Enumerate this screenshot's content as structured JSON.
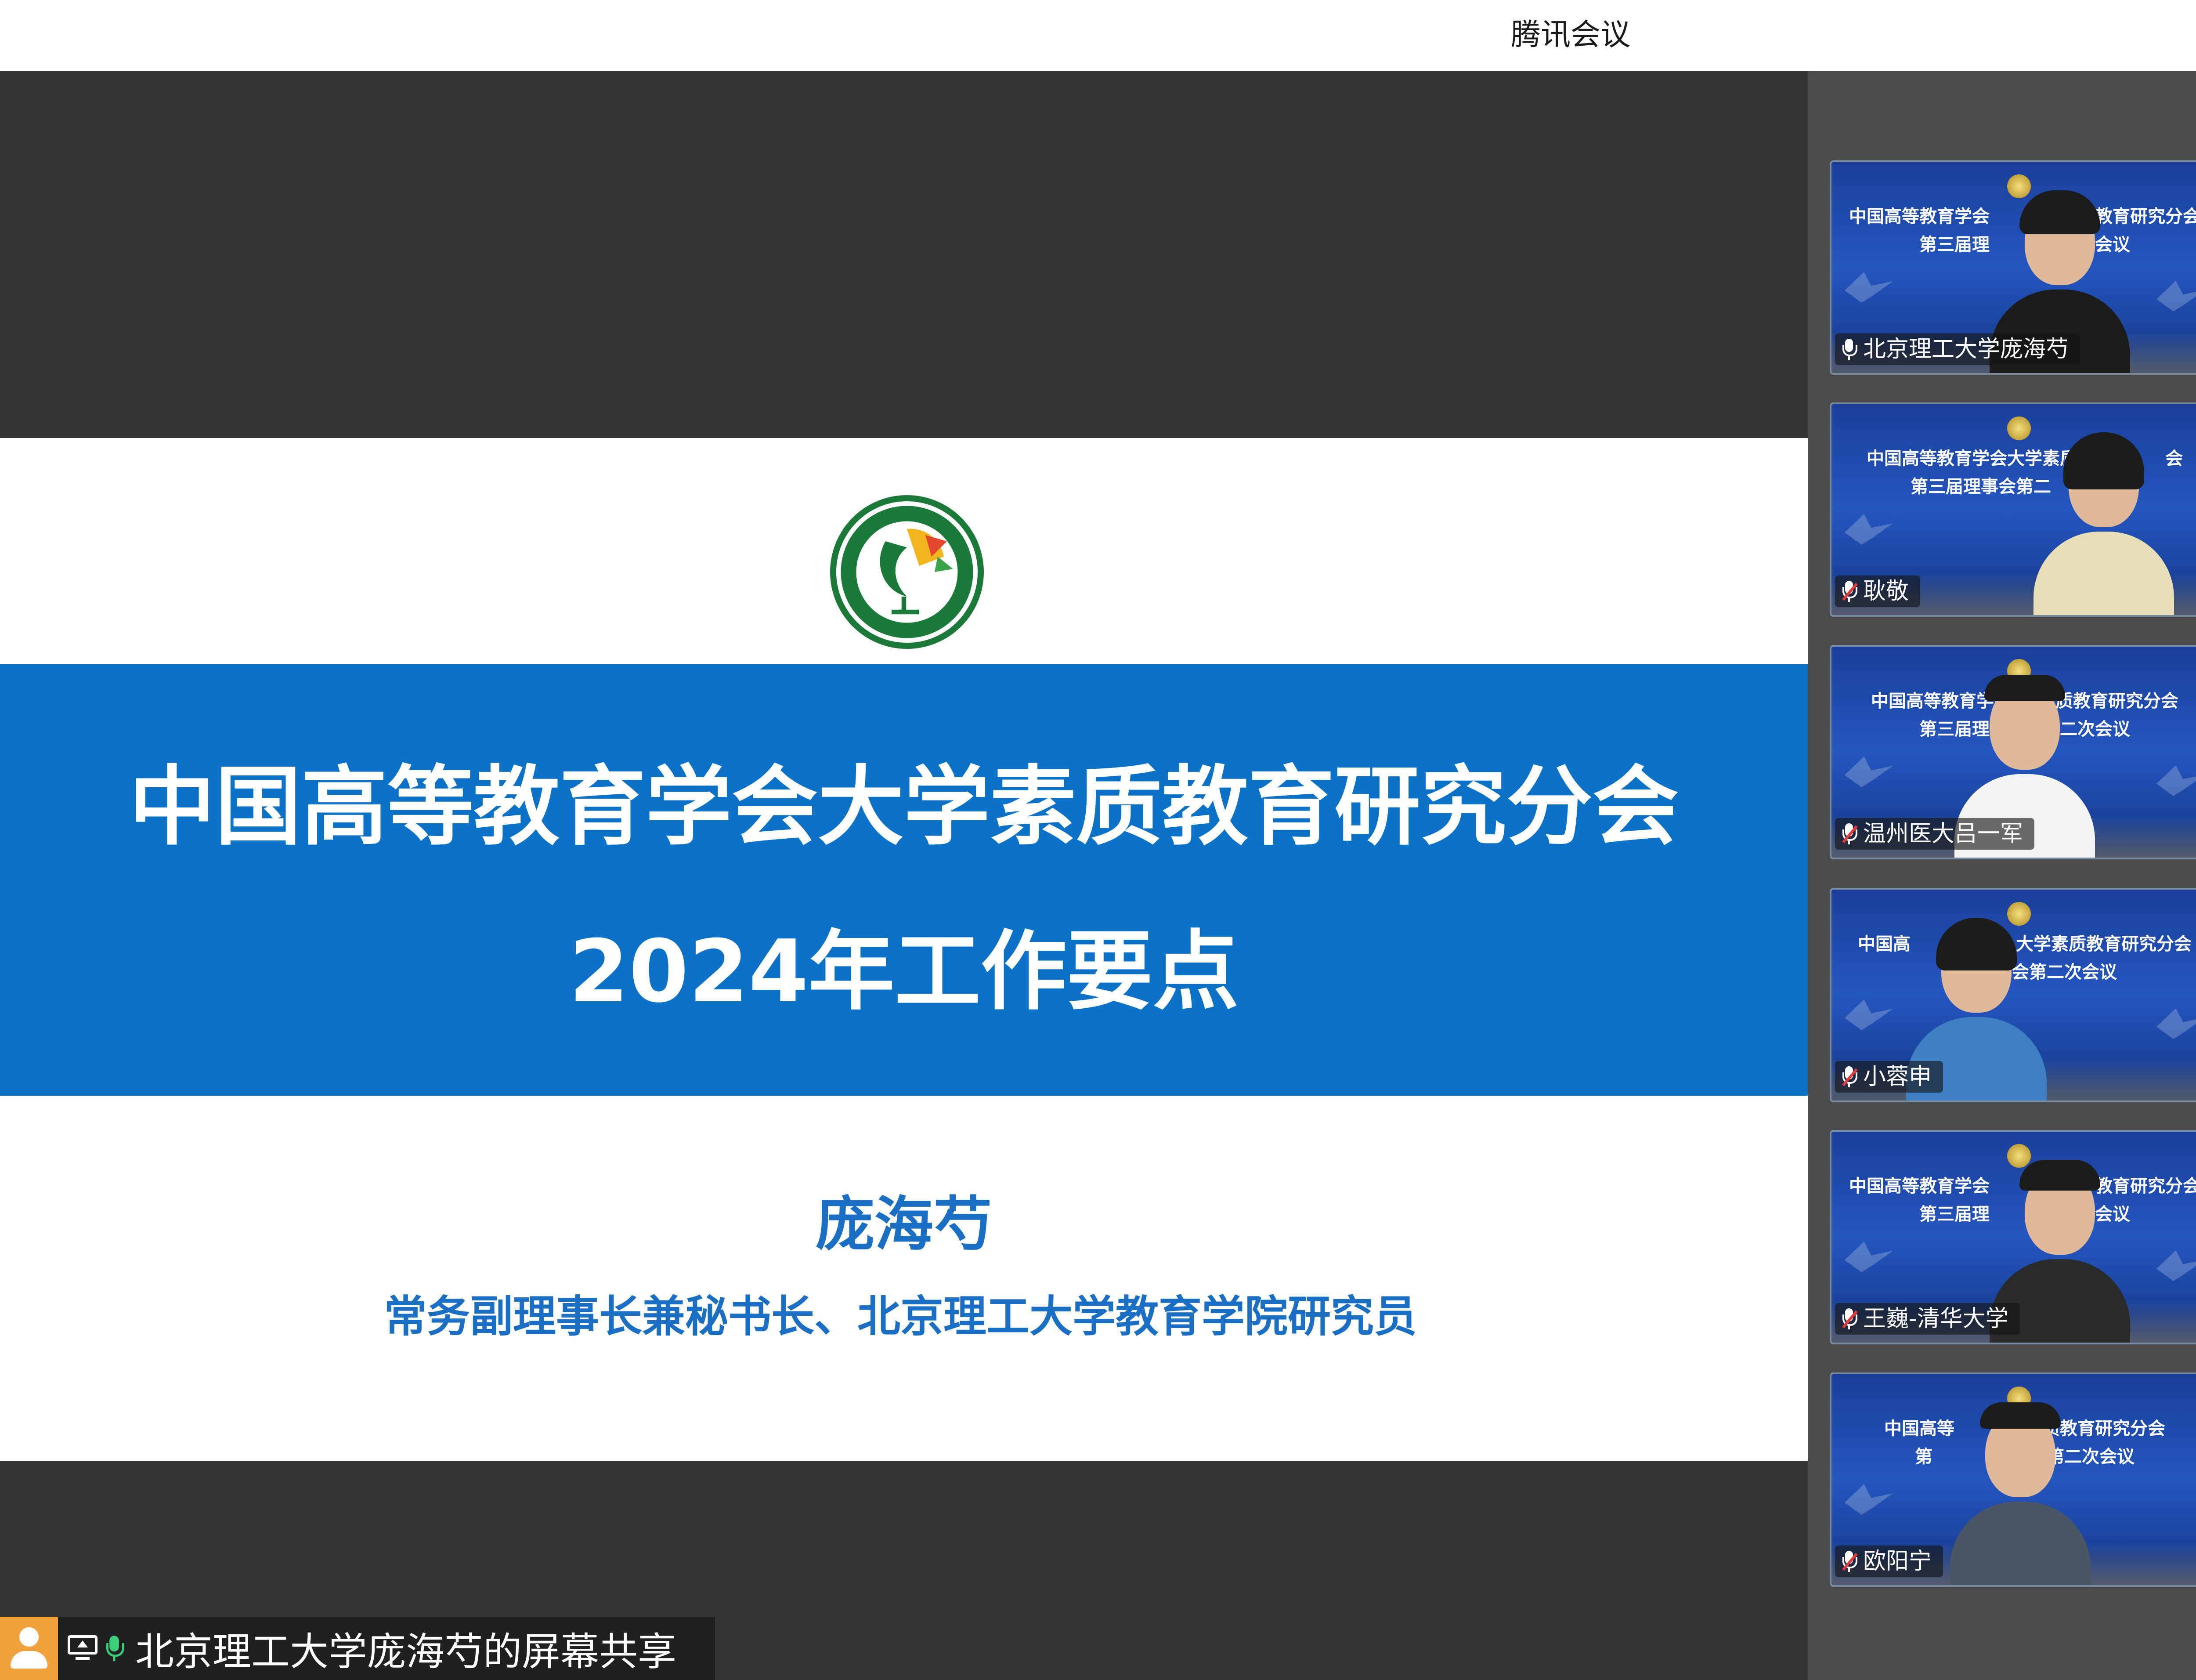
{
  "window": {
    "app_title": "腾讯会议"
  },
  "slide": {
    "logo_icon": "association-seal-icon",
    "title": "中国高等教育学会大学素质教育研究分会",
    "subtitle": "2024年工作要点",
    "speaker": "庞海芍",
    "speaker_title": "常务副理事长兼秘书长、北京理工大学教育学院研究员",
    "band_color": "#0c72c8",
    "text_accent": "#1a6fc4"
  },
  "participants": [
    {
      "name": "北京理工大学庞海芍",
      "mic": "on",
      "banner_line1": "中国高等教育学会",
      "banner_line2": "第三届理",
      "banner_line1_b": "教育研究分会",
      "banner_line2_b": "会议"
    },
    {
      "name": "耿敬",
      "mic": "muted",
      "banner_line1": "中国高等教育学会大学素质",
      "banner_line2": "第三届理事会第二",
      "banner_line1_b": "会",
      "banner_line2_b": ""
    },
    {
      "name": "温州医大吕一军",
      "mic": "muted",
      "banner_line1": "中国高等教育学会",
      "banner_line2": "第三届理事",
      "banner_line1_b": "素质教育研究分会",
      "banner_line2_b": "二次会议"
    },
    {
      "name": "小蓉申",
      "mic": "muted",
      "banner_line1": "中国高",
      "banner_line2": "",
      "banner_line1_b": "大学素质教育研究分会",
      "banner_line2_b": "会第二次会议"
    },
    {
      "name": "王巍-清华大学",
      "mic": "muted",
      "banner_line1": "中国高等教育学会",
      "banner_line2": "第三届理",
      "banner_line1_b": "教育研究分会",
      "banner_line2_b": "会议"
    },
    {
      "name": "欧阳宁",
      "mic": "muted",
      "banner_line1": "中国高等",
      "banner_line2": "第",
      "banner_line1_b": "素质教育研究分会",
      "banner_line2_b": "第二次会议"
    }
  ],
  "share_bar": {
    "label": "北京理工大学庞海芍的屏幕共享",
    "icons": [
      "user-avatar-icon",
      "screen-share-icon",
      "microphone-icon"
    ]
  }
}
